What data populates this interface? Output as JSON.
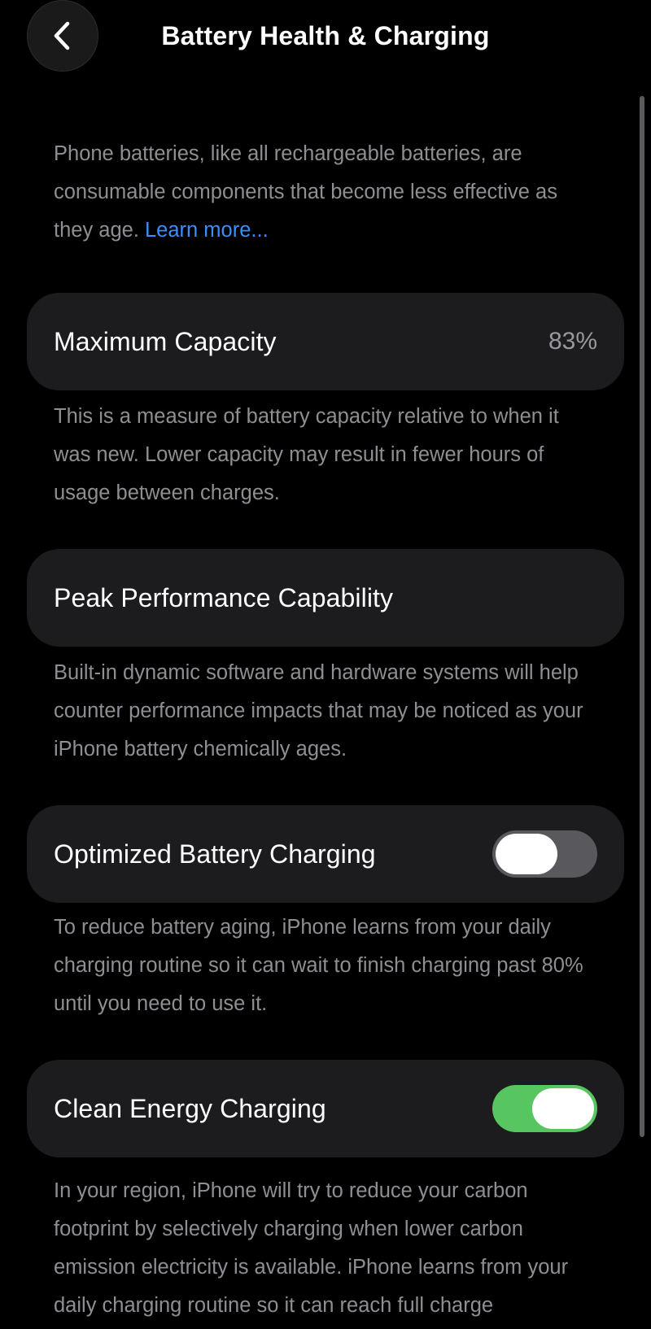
{
  "header": {
    "title": "Battery Health & Charging",
    "back_icon": "chevron-left-icon"
  },
  "intro": {
    "text": "Phone batteries, like all rechargeable batteries, are consumable components that become less effective as they age. ",
    "link_label": "Learn more..."
  },
  "maximum_capacity": {
    "label": "Maximum Capacity",
    "value": "83%",
    "description": "This is a measure of battery capacity relative to when it was new. Lower capacity may result in fewer hours of usage between charges."
  },
  "peak_performance": {
    "label": "Peak Performance Capability",
    "description": "Built-in dynamic software and hardware systems will help counter performance impacts that may be noticed as your iPhone battery chemically ages."
  },
  "optimized_charging": {
    "label": "Optimized Battery Charging",
    "enabled": false,
    "description": "To reduce battery aging, iPhone learns from your daily charging routine so it can wait to finish charging past 80% until you need to use it."
  },
  "clean_energy_charging": {
    "label": "Clean Energy Charging",
    "enabled": true,
    "description": "In your region, iPhone will try to reduce your carbon footprint by selectively charging when lower carbon emission electricity is available. iPhone learns from your daily charging routine so it can reach full charge"
  },
  "colors": {
    "background": "#000000",
    "card": "#1c1c1e",
    "secondary_text": "#8e8e93",
    "link": "#3e8ef7",
    "toggle_on": "#58c660",
    "toggle_off": "#58585d"
  }
}
